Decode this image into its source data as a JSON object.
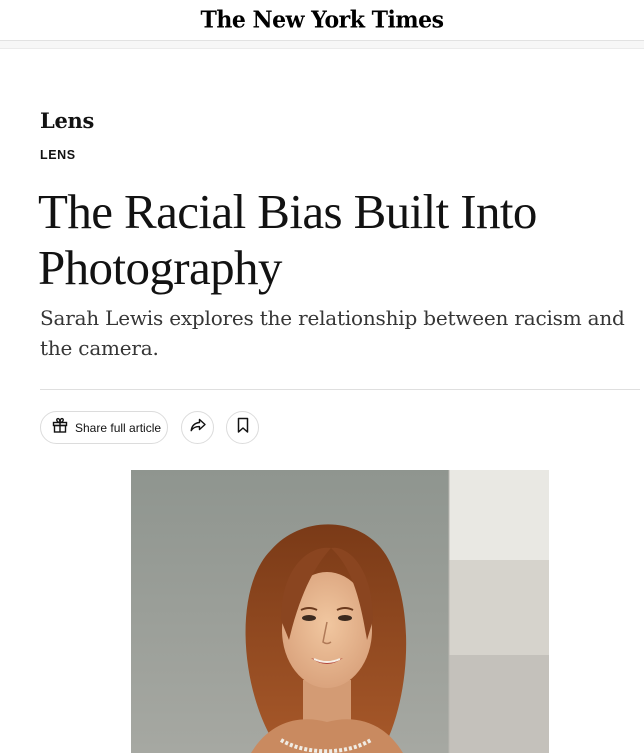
{
  "masthead": {
    "logo_text": "The New York Times"
  },
  "article": {
    "section_name": "Lens",
    "kicker": "LENS",
    "headline": "The Racial Bias Built Into Photography",
    "summary": "Sarah Lewis explores the relationship between racism and the camera."
  },
  "actions": {
    "share_full_article_label": "Share full article",
    "share_icon": "share-arrow-icon",
    "save_icon": "bookmark-icon",
    "gift_icon": "gift-icon"
  },
  "lead_image": {
    "subject": "vintage portrait photograph of a woman with long auburn hair beside a gray tone-scale strip"
  },
  "colors": {
    "text": "#121212",
    "summary_text": "#363636",
    "divider": "#dfdfdf",
    "button_border": "#dcdcdc"
  }
}
